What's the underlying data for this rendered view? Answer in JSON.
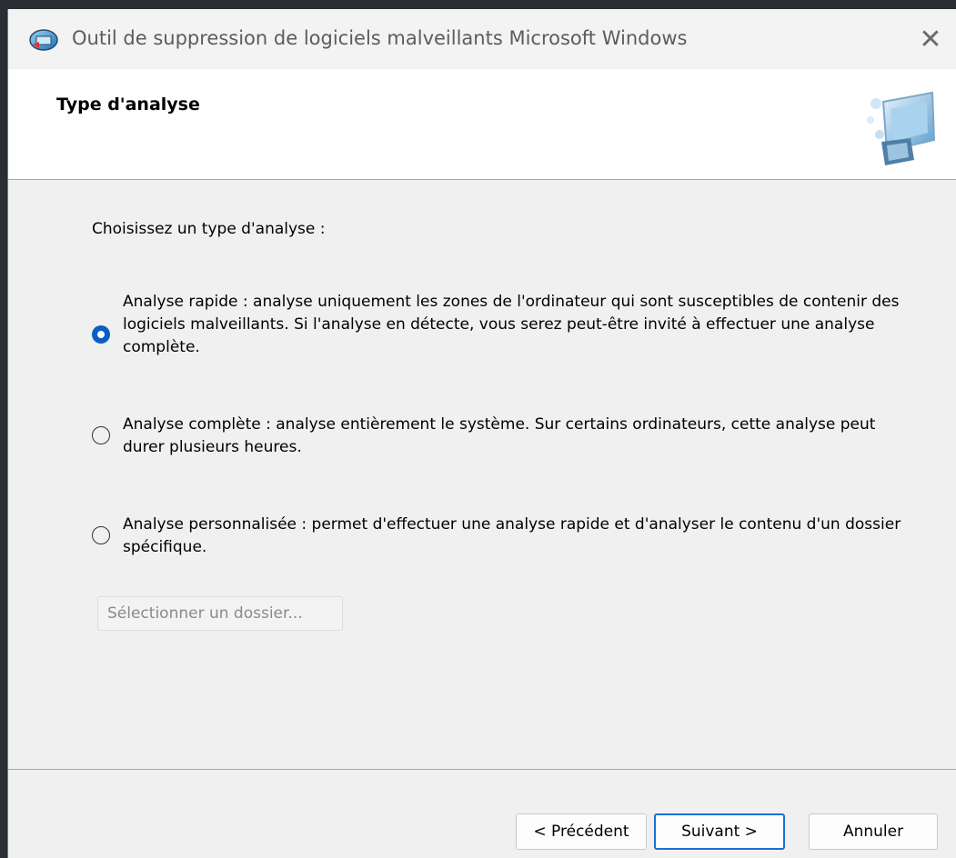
{
  "window": {
    "title": "Outil de suppression de logiciels malveillants Microsoft Windows",
    "close_glyph": "✕"
  },
  "header": {
    "title": "Type d'analyse",
    "icon": "computer-scan-icon"
  },
  "main": {
    "prompt": "Choisissez un type d'analyse :",
    "options": [
      {
        "label": "Analyse rapide : analyse uniquement les zones de l'ordinateur qui sont susceptibles de contenir des logiciels malveillants. Si l'analyse en détecte, vous serez peut-être invité à effectuer une analyse complète.",
        "checked": true
      },
      {
        "label": "Analyse complète : analyse entièrement le système. Sur certains ordinateurs, cette analyse peut durer plusieurs heures.",
        "checked": false
      },
      {
        "label": "Analyse personnalisée : permet d'effectuer une analyse rapide et d'analyser le contenu d'un dossier spécifique.",
        "checked": false
      }
    ],
    "select_folder_label": "Sélectionner un dossier..."
  },
  "footer": {
    "back_label": "< Précédent",
    "next_label": "Suivant >",
    "cancel_label": "Annuler"
  },
  "colors": {
    "accent": "#0a5fc4",
    "dialog_bg": "#f0f0f0",
    "header_bg": "#ffffff"
  }
}
